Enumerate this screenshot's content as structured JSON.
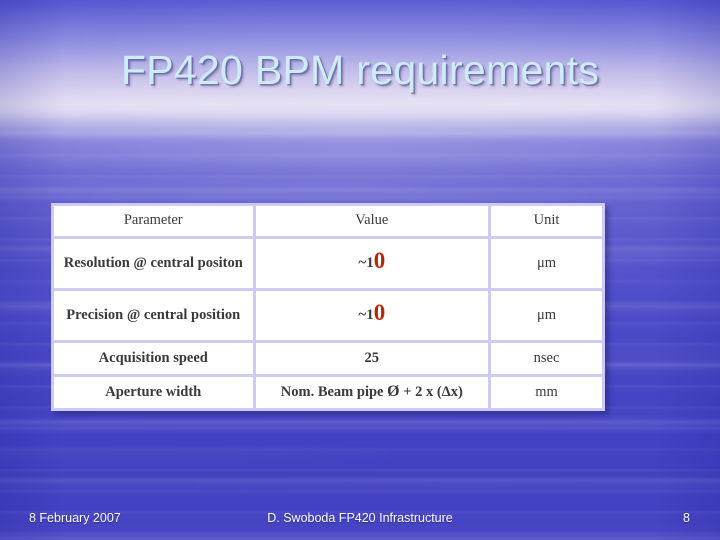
{
  "slide": {
    "title": "FP420 BPM requirements",
    "title_color": "#CDECF6",
    "background_color": "#4A47C6",
    "accent_color": "#CCCCF2",
    "highlight_color": "#B52A06"
  },
  "table": {
    "headers": [
      "Parameter",
      "Value",
      "Unit"
    ],
    "rows": [
      {
        "parameter": "Resolution @ central positon",
        "value_prefix": "~1",
        "value_highlight": "0",
        "unit": "μm"
      },
      {
        "parameter": "Precision @ central position",
        "value_prefix": "~1",
        "value_highlight": "0",
        "unit": "μm"
      },
      {
        "parameter": "Acquisition speed",
        "value": "25",
        "unit": "nsec"
      },
      {
        "parameter": "Aperture width",
        "value_lead": "Nom. Beam pipe ",
        "value_symbol": "Ø",
        "value_tail": " + 2 x (Δx)",
        "unit": "mm"
      }
    ]
  },
  "footer": {
    "date": "8 February 2007",
    "center": "D. Swoboda FP420 Infrastructure",
    "page_number": "8"
  }
}
